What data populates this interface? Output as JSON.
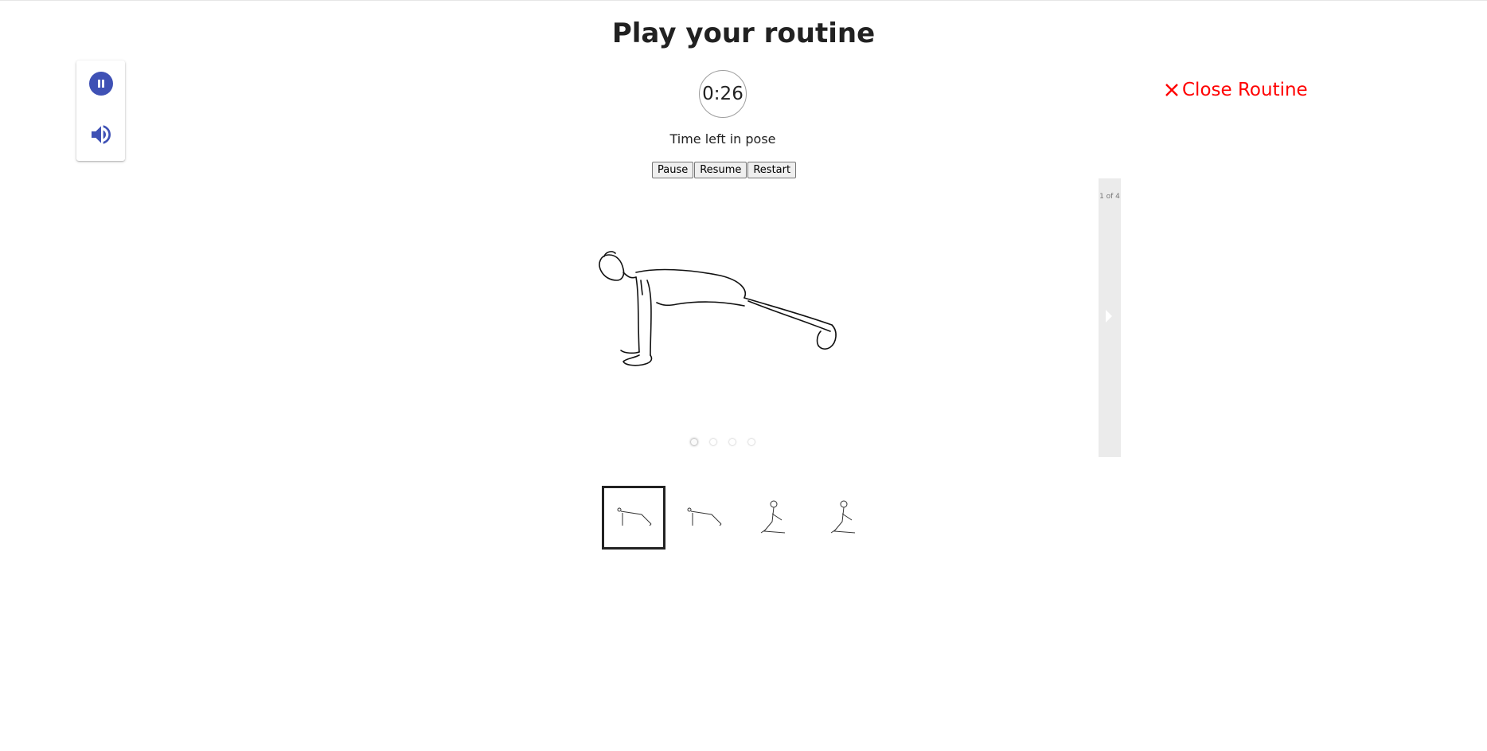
{
  "header": {
    "title": "Play your routine"
  },
  "controls": {
    "pause_icon": "pause-circle-icon",
    "volume_icon": "volume-up-icon",
    "accent_color": "#3f51b5"
  },
  "timer": {
    "value": "0:26",
    "label": "Time left in pose"
  },
  "buttons": {
    "pause": "Pause",
    "resume": "Resume",
    "restart": "Restart"
  },
  "close": {
    "label": "Close Routine",
    "icon": "close-icon",
    "color": "#ff0000"
  },
  "carousel": {
    "counter": "1 of 4",
    "current_pose": "plank-pose",
    "dots": 4,
    "active_index": 0
  },
  "thumbnails": [
    {
      "pose": "plank-pose",
      "selected": true
    },
    {
      "pose": "plank-pose",
      "selected": false
    },
    {
      "pose": "seated-pose",
      "selected": false
    },
    {
      "pose": "seated-pose",
      "selected": false
    }
  ]
}
